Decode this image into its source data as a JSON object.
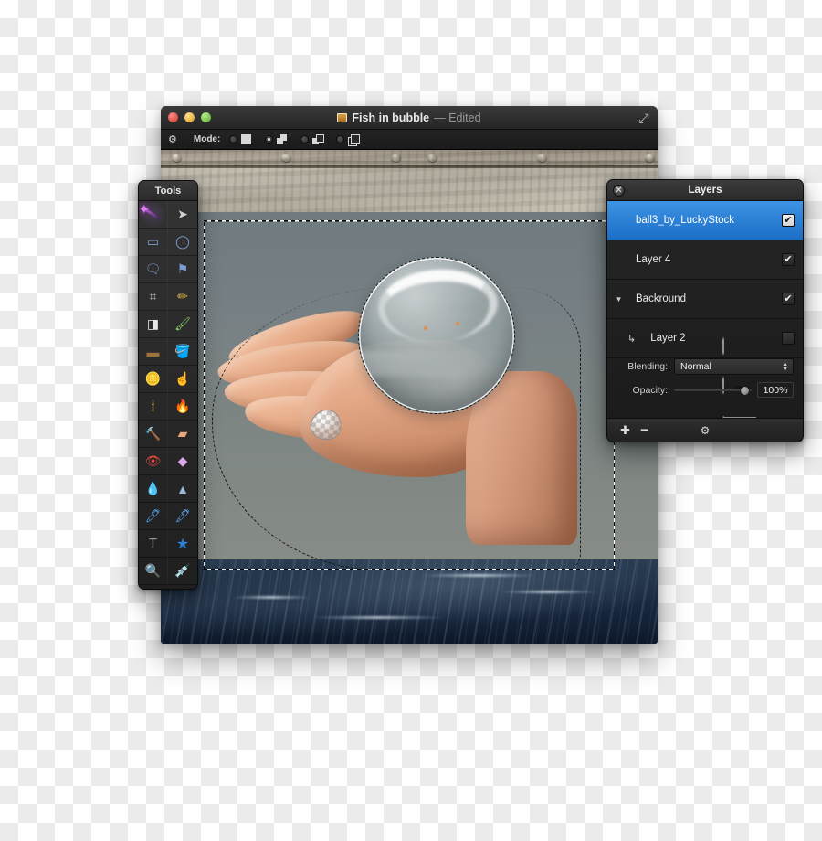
{
  "window": {
    "title": "Fish in bubble",
    "title_suffix": "— Edited",
    "doc_icon": "image-document-icon",
    "expand_icon": "⤢",
    "traffic": {
      "close": "close-button",
      "minimize": "minimize-button",
      "zoom": "zoom-button"
    }
  },
  "optionsbar": {
    "gear_icon": "⚙",
    "mode_label": "Mode:",
    "modes": [
      {
        "name": "new-selection",
        "selected": false
      },
      {
        "name": "add-to-selection",
        "selected": true
      },
      {
        "name": "subtract-from-selection",
        "selected": false
      },
      {
        "name": "intersect-selection",
        "selected": false
      }
    ]
  },
  "tools": {
    "title": "Tools",
    "items": [
      {
        "name": "magic-wand-tool",
        "glyph": "",
        "selected": true
      },
      {
        "name": "move-tool",
        "glyph": "➤"
      },
      {
        "name": "rectangular-marquee-tool",
        "glyph": "▭"
      },
      {
        "name": "elliptical-marquee-tool",
        "glyph": "◯"
      },
      {
        "name": "lasso-tool",
        "glyph": "🗨"
      },
      {
        "name": "polygonal-lasso-tool",
        "glyph": "⚑"
      },
      {
        "name": "crop-tool",
        "glyph": "⌗"
      },
      {
        "name": "pencil-tool",
        "glyph": "✏"
      },
      {
        "name": "eraser-tool",
        "glyph": "◨"
      },
      {
        "name": "paintbrush-tool",
        "glyph": "🖌"
      },
      {
        "name": "gradient-tool",
        "glyph": "▬"
      },
      {
        "name": "paint-bucket-tool",
        "glyph": "🪣"
      },
      {
        "name": "dodge-tool",
        "glyph": "🪙"
      },
      {
        "name": "smudge-tool",
        "glyph": "☝"
      },
      {
        "name": "burn-tool",
        "glyph": "🕯"
      },
      {
        "name": "blur-tool",
        "glyph": "🔥"
      },
      {
        "name": "clone-stamp-tool",
        "glyph": "🔨"
      },
      {
        "name": "healing-brush-tool",
        "glyph": "▰"
      },
      {
        "name": "red-eye-tool",
        "glyph": "👁"
      },
      {
        "name": "sharpen-tool",
        "glyph": "◆"
      },
      {
        "name": "water-drop-tool",
        "glyph": "💧"
      },
      {
        "name": "cone-gradient-tool",
        "glyph": "▲"
      },
      {
        "name": "brush-tool",
        "glyph": "🖊"
      },
      {
        "name": "pen-tool",
        "glyph": "🖋"
      },
      {
        "name": "type-tool",
        "glyph": "T"
      },
      {
        "name": "shape-tool",
        "glyph": "★"
      },
      {
        "name": "zoom-tool",
        "glyph": "🔍"
      },
      {
        "name": "eyedropper-tool",
        "glyph": "💉"
      }
    ]
  },
  "layers_panel": {
    "title": "Layers",
    "close_icon": "✕",
    "layers": [
      {
        "name": "ball3_by_LuckyStock",
        "visible": true,
        "selected": true,
        "indent": 0,
        "group": false,
        "clipped": false
      },
      {
        "name": "Layer 4",
        "visible": true,
        "selected": false,
        "indent": 0,
        "group": false,
        "clipped": false
      },
      {
        "name": "Backround",
        "visible": true,
        "selected": false,
        "indent": 0,
        "group": true,
        "clipped": false
      },
      {
        "name": "Layer 2",
        "visible": false,
        "selected": false,
        "indent": 1,
        "group": false,
        "clipped": true
      }
    ],
    "blending_label": "Blending:",
    "blending_value": "Normal",
    "opacity_label": "Opacity:",
    "opacity_value": "100%",
    "opacity_percent": 100,
    "add_icon": "✚",
    "remove_icon": "━",
    "gear_icon": "⚙"
  },
  "artwork": {
    "description": "hand holding a glass sphere above dark ocean water, weathered riveted wall behind",
    "selection_active": true
  },
  "colors": {
    "accent_blue": "#3d93e4",
    "accent_blue_dark": "#1b6ec6",
    "panel_dark": "#1f1f1f",
    "titlebar": "#2f2f2f",
    "water": "#15233a",
    "wall": "#c9c4b6",
    "skin": "#e4a886"
  }
}
